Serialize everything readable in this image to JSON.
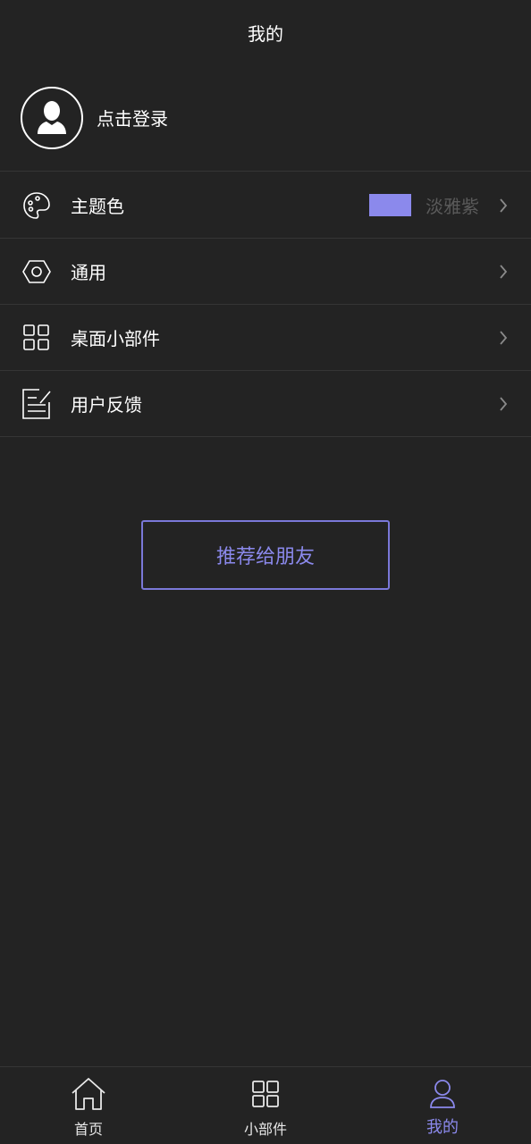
{
  "header": {
    "title": "我的"
  },
  "profile": {
    "login_label": "点击登录"
  },
  "menu": {
    "theme": {
      "label": "主题色",
      "value": "淡雅紫",
      "swatch_color": "#8b89ec"
    },
    "general": {
      "label": "通用"
    },
    "widgets": {
      "label": "桌面小部件"
    },
    "feedback": {
      "label": "用户反馈"
    }
  },
  "share": {
    "label": "推荐给朋友"
  },
  "tabbar": {
    "home": {
      "label": "首页",
      "icon": "home-icon"
    },
    "widgets": {
      "label": "小部件",
      "icon": "grid-icon"
    },
    "mine": {
      "label": "我的",
      "icon": "person-icon"
    }
  },
  "colors": {
    "accent": "#8b89ec",
    "background": "#232323",
    "divider": "#353535",
    "muted_text": "#5a5a5a"
  }
}
